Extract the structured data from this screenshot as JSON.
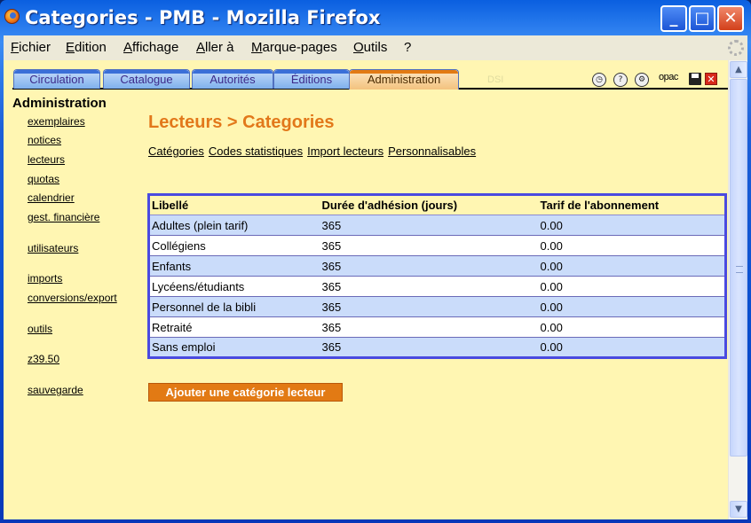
{
  "window": {
    "title": "Categories - PMB - Mozilla Firefox"
  },
  "menubar": [
    "Fichier",
    "Edition",
    "Affichage",
    "Aller à",
    "Marque-pages",
    "Outils",
    "?"
  ],
  "tabs": [
    {
      "label": "Circulation",
      "active": false
    },
    {
      "label": "Catalogue",
      "active": false
    },
    {
      "label": "Autorités",
      "active": false
    },
    {
      "label": "Éditions",
      "active": false
    },
    {
      "label": "Administration",
      "active": true
    }
  ],
  "ghost_tab": "DSI",
  "toolbar": {
    "opac_label": "opac",
    "icons": [
      "clock-icon",
      "help-icon",
      "settings-icon",
      "opac-icon",
      "save-icon",
      "close-icon"
    ]
  },
  "sidebar": {
    "title": "Administration",
    "items": [
      "exemplaires",
      "notices",
      "lecteurs",
      "quotas",
      "calendrier",
      "gest. financière",
      "utilisateurs",
      "imports",
      "conversions/export",
      "outils",
      "z39.50",
      "sauvegarde"
    ]
  },
  "main": {
    "title": "Lecteurs > Categories",
    "sublinks": [
      "Catégories",
      "Codes statistiques",
      "Import lecteurs",
      "Personnalisables"
    ],
    "table": {
      "headers": [
        "Libellé",
        "Durée d'adhésion (jours)",
        "Tarif de l'abonnement"
      ],
      "rows": [
        [
          "Adultes (plein tarif)",
          "365",
          "0.00"
        ],
        [
          "Collégiens",
          "365",
          "0.00"
        ],
        [
          "Enfants",
          "365",
          "0.00"
        ],
        [
          "Lycéens/étudiants",
          "365",
          "0.00"
        ],
        [
          "Personnel de la bibli",
          "365",
          "0.00"
        ],
        [
          "Retraité",
          "365",
          "0.00"
        ],
        [
          "Sans emploi",
          "365",
          "0.00"
        ]
      ]
    },
    "add_button": "Ajouter une catégorie lecteur"
  },
  "colors": {
    "accent": "#e2781a",
    "table_border": "#4a4ae0",
    "row_alt": "#cadcfa",
    "page_bg": "#fff6b2"
  }
}
